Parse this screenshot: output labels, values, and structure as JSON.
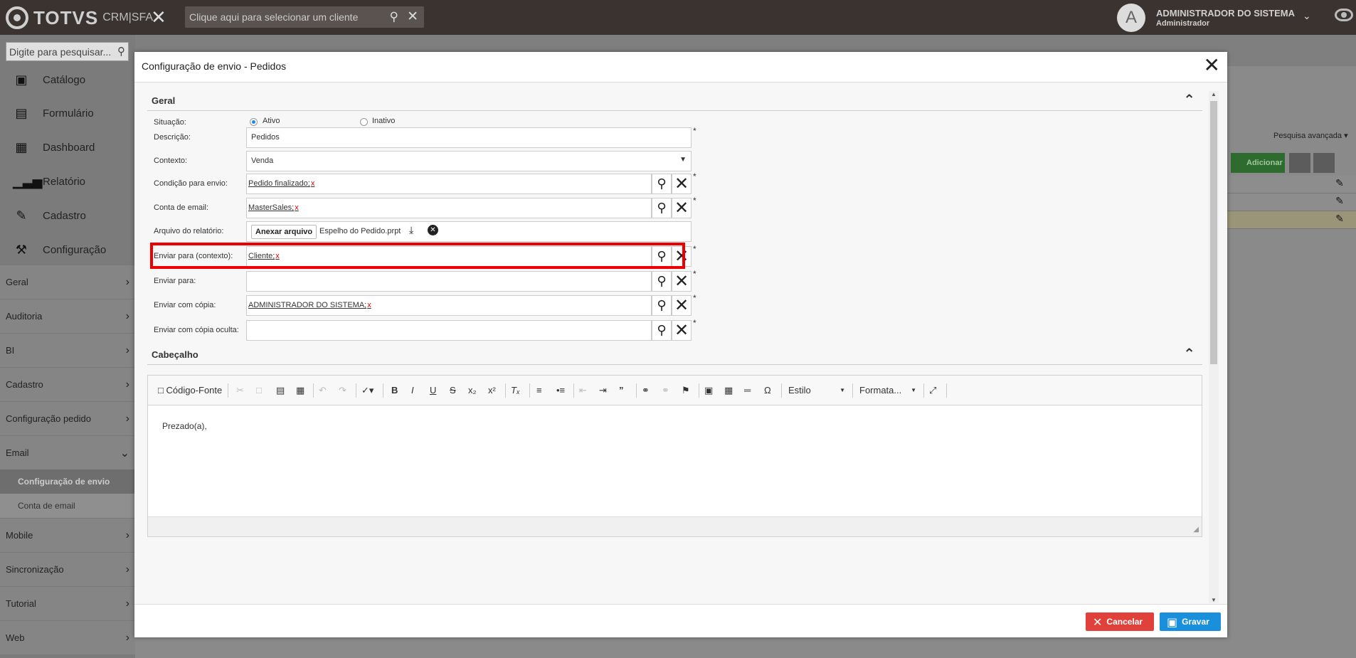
{
  "topbar": {
    "logo": "TOTVS",
    "product": "CRM|SFA",
    "client_placeholder": "Clique aqui para selecionar um cliente",
    "avatar_letter": "A",
    "user_name": "ADMINISTRADOR DO SISTEMA",
    "user_role": "Administrador"
  },
  "sidebar": {
    "search_placeholder": "Digite para pesquisar...",
    "modules": [
      "Catálogo",
      "Formulário",
      "Dashboard",
      "Relatório",
      "Cadastro",
      "Configuração"
    ],
    "sections": [
      "Geral",
      "Auditoria",
      "BI",
      "Cadastro",
      "Configuração pedido",
      "Email"
    ],
    "email_items": [
      "Configuração de envio",
      "Conta de email"
    ],
    "sections_after": [
      "Mobile",
      "Sincronização",
      "Tutorial",
      "Web"
    ]
  },
  "background": {
    "advanced_search": "Pesquisa avançada",
    "add_button": "Adicionar"
  },
  "modal": {
    "title": "Configuração de envio - Pedidos",
    "section_general": "Geral",
    "section_header": "Cabeçalho",
    "labels": {
      "situacao": "Situação:",
      "descricao": "Descrição:",
      "contexto": "Contexto:",
      "condicao": "Condição para envio:",
      "conta": "Conta de email:",
      "arquivo": "Arquivo do relatório:",
      "enviar_contexto": "Enviar para (contexto):",
      "enviar_para": "Enviar para:",
      "enviar_copia": "Enviar com cópia:",
      "enviar_copia_oculta": "Enviar com cópia oculta:"
    },
    "values": {
      "ativo": "Ativo",
      "inativo": "Inativo",
      "descricao": "Pedidos",
      "contexto": "Venda",
      "condicao": "Pedido finalizado;",
      "conta": "MasterSales;",
      "attach_button": "Anexar arquivo",
      "file_name": "Espelho do Pedido.prpt",
      "enviar_contexto": "Cliente;",
      "enviar_copia": "ADMINISTRADOR DO SISTEMA;"
    },
    "editor": {
      "source_label": "Código-Fonte",
      "style_label": "Estilo",
      "format_label": "Formata...",
      "content": "Prezado(a),"
    },
    "buttons": {
      "cancel": "Cancelar",
      "save": "Gravar"
    }
  }
}
